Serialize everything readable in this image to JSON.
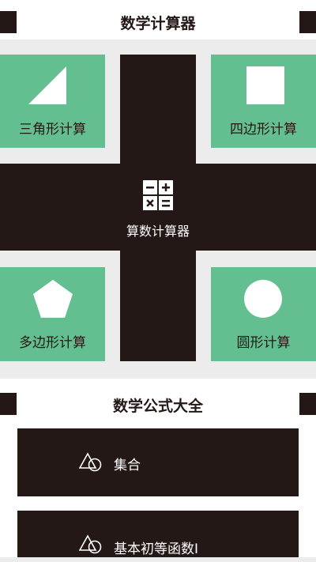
{
  "header": {
    "title": "数学计算器"
  },
  "tiles": {
    "triangle": {
      "label": "三角形计算",
      "icon": "triangle-icon"
    },
    "quadrilateral": {
      "label": "四边形计算",
      "icon": "square-icon"
    },
    "arithmetic": {
      "label": "算数计算器",
      "icon": "calculator-icon"
    },
    "polygon": {
      "label": "多边形计算",
      "icon": "pentagon-icon"
    },
    "circle": {
      "label": "圆形计算",
      "icon": "circle-icon"
    }
  },
  "formulas": {
    "title": "数学公式大全",
    "items": [
      {
        "label": "集合",
        "icon": "shapes-icon"
      },
      {
        "label": "基本初等函数I",
        "icon": "shapes-icon"
      }
    ]
  },
  "colors": {
    "dark": "#231816",
    "green": "#63bf8f",
    "grey": "#ececec",
    "white": "#ffffff"
  }
}
